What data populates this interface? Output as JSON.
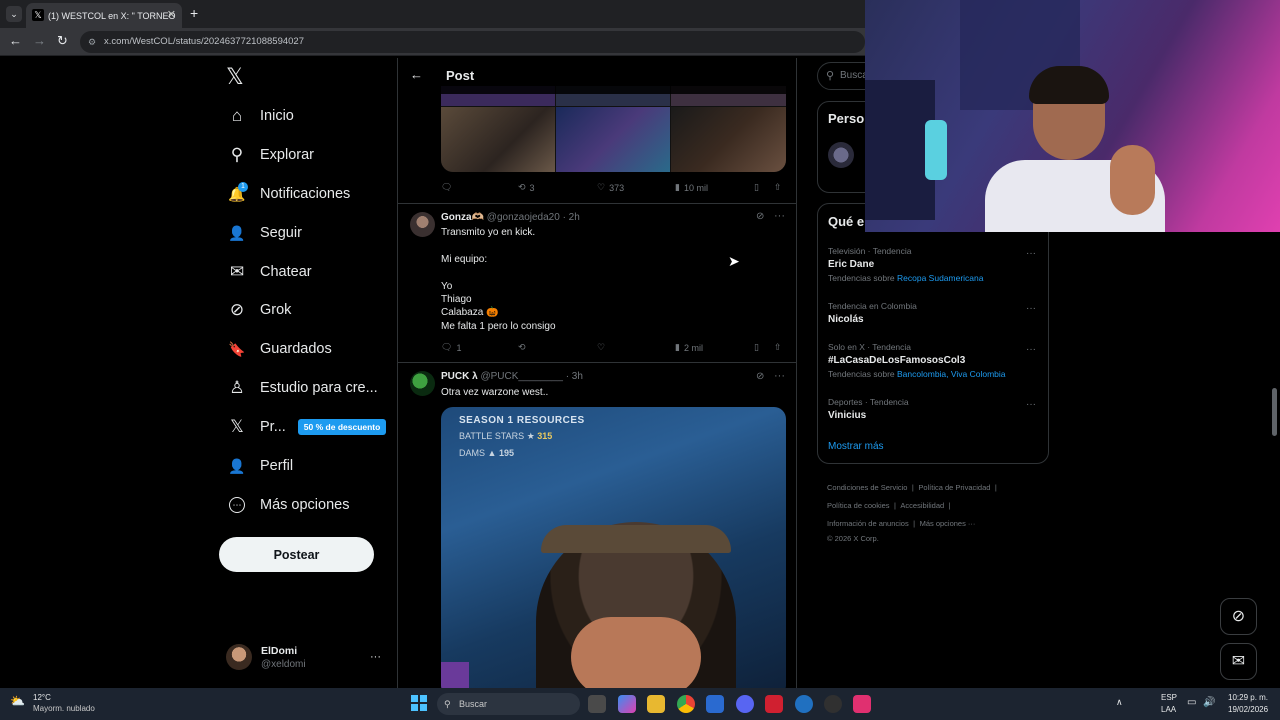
{
  "browser": {
    "tab_title": "(1) WESTCOL en X: \" TORNEO",
    "tab_close": "✕",
    "new_tab": "+",
    "url": "x.com/WestCOL/status/2024637721088594027"
  },
  "nav": {
    "items": [
      {
        "label": "Inicio",
        "icon": "home-icon",
        "glyph": "⌂"
      },
      {
        "label": "Explorar",
        "icon": "search-icon",
        "glyph": "⚲"
      },
      {
        "label": "Notificaciones",
        "icon": "bell-icon",
        "glyph": "🔔"
      },
      {
        "label": "Seguir",
        "icon": "follow-icon",
        "glyph": "👤"
      },
      {
        "label": "Chatear",
        "icon": "mail-icon",
        "glyph": "✉"
      },
      {
        "label": "Grok",
        "icon": "grok-icon",
        "glyph": "⊘"
      },
      {
        "label": "Guardados",
        "icon": "bookmark-icon",
        "glyph": "🔖"
      },
      {
        "label": "Estudio para cre...",
        "icon": "studio-icon",
        "glyph": "♙"
      },
      {
        "label": "Pr...",
        "icon": "x-logo-icon",
        "glyph": "𝕏"
      },
      {
        "label": "Perfil",
        "icon": "profile-icon",
        "glyph": "👤"
      },
      {
        "label": "Más opciones",
        "icon": "more-icon",
        "glyph": "⋯"
      }
    ],
    "notif_badge": "1",
    "premium_badge": "50 % de descuento",
    "post_button": "Postear",
    "account_name": "ElDomi",
    "account_handle": "@xeldomi",
    "account_more": "···"
  },
  "header": {
    "title": "Post"
  },
  "tweet1_actions": {
    "replies": "",
    "retweets": "3",
    "likes": "373",
    "views": "10 mil"
  },
  "tweet2": {
    "name": "Gonza🫶🏼",
    "handle": "@gonzaojeda20",
    "time": "· 2h",
    "lines": [
      "Transmito yo en kick.",
      "",
      "Mi equipo:",
      "",
      "Yo",
      "Thiago",
      "Calabaza 🎃",
      "Me falta 1 pero lo consigo"
    ],
    "replies": "1",
    "retweets": "",
    "likes": "",
    "views": "2 mil"
  },
  "tweet3": {
    "name": "PUCK λ",
    "handle": "@PUCK________",
    "time": "· 3h",
    "text": "Otra vez warzone west..",
    "media_text1": "SEASON 1 RESOURCES",
    "media_text2": "BATTLE STARS",
    "media_value2": "315",
    "media_text3": "DAMS",
    "media_value3": "195"
  },
  "right": {
    "search_placeholder": "Busca",
    "persons_title": "Perso",
    "trends_title": "Qué e",
    "trends": [
      {
        "category": "Televisión · Tendencia",
        "name": "Eric Dane",
        "sub_prefix": "Tendencias sobre",
        "sub_links": "Recopa Sudamericana"
      },
      {
        "category": "Tendencia en Colombia",
        "name": "Nicolás",
        "sub_prefix": "",
        "sub_links": ""
      },
      {
        "category": "Solo en X · Tendencia",
        "name": "#LaCasaDeLosFamososCol3",
        "sub_prefix": "Tendencias sobre",
        "sub_links": "Bancolombia, Viva Colombia"
      },
      {
        "category": "Deportes · Tendencia",
        "name": "Vinicius",
        "sub_prefix": "",
        "sub_links": ""
      }
    ],
    "show_more": "Mostrar más",
    "footer": {
      "l1": "Condiciones de Servicio",
      "l2": "Política de Privacidad",
      "l3": "Política de cookies",
      "l4": "Accesibilidad",
      "l5": "Información de anuncios",
      "l6": "Más opciones ···",
      "l7": "© 2026 X Corp."
    }
  },
  "taskbar": {
    "temp": "12°C",
    "weather": "Mayorm. nublado",
    "search": "Buscar",
    "lang1": "ESP",
    "lang2": "LAA",
    "time": "10:29 p. m.",
    "date": "19/02/2026"
  },
  "colors": {
    "accent": "#1d9bf0",
    "background": "#000000",
    "border": "#2f3336"
  }
}
